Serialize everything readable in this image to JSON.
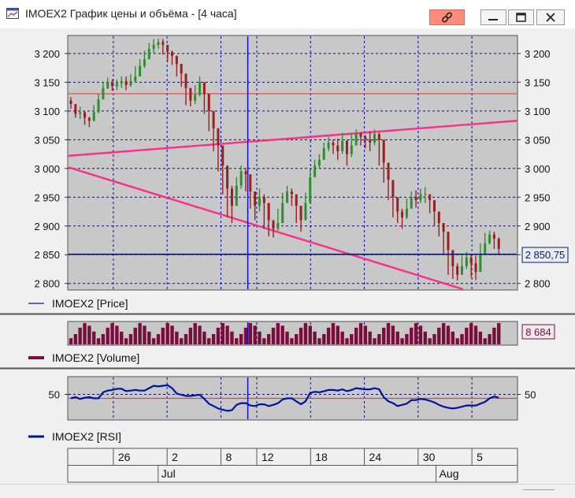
{
  "window": {
    "title": "IMOEX2 График цены и объёма - [4 часа]",
    "icons": {
      "app": "chart-icon",
      "link": "link-icon",
      "minimize": "minimize-icon",
      "maximize": "maximize-icon",
      "close": "close-icon"
    }
  },
  "colors": {
    "panel_bg": "#c8c8c8",
    "grid": "#0a0a9a",
    "up_candle": "#2f8f2f",
    "down_candle": "#9b1f1f",
    "trendline": "#ff2d8a",
    "level_line": "#e84040",
    "cursor": "#1010c0",
    "current_price": "#0a1a6a",
    "volume": "#7a0e3a",
    "rsi": "#00139f",
    "rsi_level": "#e84040"
  },
  "price_panel": {
    "legend": "IMOEX2 [Price]",
    "y_ticks": [
      "3 200",
      "3 150",
      "3 100",
      "3 050",
      "3 000",
      "2 950",
      "2 900",
      "2 850",
      "2 800"
    ],
    "current_value": "2 850,75"
  },
  "volume_panel": {
    "legend": "IMOEX2 [Volume]",
    "current_value": "8 684"
  },
  "rsi_panel": {
    "legend": "IMOEX2 [RSI]",
    "y_ticks": [
      "50"
    ]
  },
  "x_axis": {
    "day_ticks": [
      "26",
      "2",
      "8",
      "12",
      "18",
      "24",
      "30",
      "5"
    ],
    "month_ticks": [
      "Jul",
      "Aug"
    ]
  },
  "chart_data": [
    {
      "type": "line",
      "panel": "price",
      "title": "",
      "chart_style": "candlestick",
      "ylim": [
        2790,
        3230
      ],
      "x_range": [
        "06-21",
        "08-10"
      ],
      "x_unit": "MM-DD, 4-hour bars",
      "close": [
        3112,
        3095,
        3098,
        3088,
        3083,
        3098,
        3120,
        3140,
        3150,
        3143,
        3148,
        3152,
        3145,
        3152,
        3160,
        3178,
        3190,
        3208,
        3215,
        3220,
        3215,
        3203,
        3196,
        3182,
        3165,
        3140,
        3118,
        3128,
        3150,
        3130,
        3100,
        3070,
        3040,
        3005,
        2965,
        2935,
        2970,
        2995,
        2990,
        2960,
        2935,
        2950,
        2940,
        2910,
        2895,
        2905,
        2940,
        2960,
        2955,
        2935,
        2910,
        2940,
        2985,
        3005,
        3015,
        3035,
        3045,
        3040,
        3030,
        3048,
        3025,
        3040,
        3060,
        3055,
        3050,
        3045,
        3060,
        3050,
        3010,
        2980,
        2950,
        2925,
        2915,
        2930,
        2950,
        2945,
        2955,
        2955,
        2945,
        2925,
        2905,
        2890,
        2858,
        2830,
        2815,
        2830,
        2845,
        2835,
        2820,
        2850,
        2870,
        2885,
        2878,
        2860
      ],
      "high": [
        3124,
        3112,
        3108,
        3100,
        3090,
        3110,
        3130,
        3150,
        3158,
        3155,
        3155,
        3160,
        3160,
        3164,
        3178,
        3190,
        3205,
        3218,
        3225,
        3226,
        3225,
        3212,
        3205,
        3196,
        3175,
        3160,
        3130,
        3145,
        3160,
        3150,
        3120,
        3090,
        3060,
        3030,
        2980,
        2970,
        2985,
        3005,
        3000,
        2985,
        2960,
        2965,
        2955,
        2930,
        2905,
        2930,
        2958,
        2970,
        2965,
        2950,
        2935,
        2958,
        2998,
        3015,
        3025,
        3045,
        3055,
        3050,
        3052,
        3062,
        3050,
        3060,
        3068,
        3063,
        3058,
        3065,
        3068,
        3062,
        3040,
        3000,
        2965,
        2945,
        2930,
        2948,
        2960,
        2962,
        2965,
        2968,
        2955,
        2945,
        2920,
        2905,
        2875,
        2855,
        2835,
        2848,
        2855,
        2850,
        2848,
        2870,
        2888,
        2892,
        2890,
        2880
      ],
      "low": [
        3104,
        3088,
        3086,
        3076,
        3072,
        3082,
        3096,
        3122,
        3138,
        3135,
        3136,
        3140,
        3136,
        3142,
        3150,
        3160,
        3175,
        3192,
        3200,
        3208,
        3198,
        3185,
        3180,
        3160,
        3142,
        3110,
        3108,
        3112,
        3125,
        3095,
        3065,
        3030,
        2995,
        2955,
        2915,
        2905,
        2940,
        2965,
        2960,
        2930,
        2910,
        2925,
        2895,
        2882,
        2880,
        2892,
        2920,
        2945,
        2935,
        2905,
        2890,
        2920,
        2955,
        2985,
        3000,
        3018,
        3030,
        3025,
        3015,
        3025,
        3005,
        3020,
        3040,
        3040,
        3035,
        3030,
        3040,
        3005,
        2975,
        2945,
        2915,
        2905,
        2895,
        2912,
        2935,
        2932,
        2940,
        2940,
        2922,
        2900,
        2882,
        2850,
        2815,
        2808,
        2805,
        2815,
        2825,
        2810,
        2806,
        2830,
        2855,
        2868,
        2860,
        2852
      ],
      "horizontal_level": 3130,
      "current_price": 2850.75,
      "trendlines": [
        {
          "from": [
            "06-21",
            3022
          ],
          "to": [
            "08-10",
            3083
          ]
        },
        {
          "from": [
            "06-21",
            3002
          ],
          "to": [
            "08-04",
            2790
          ]
        }
      ],
      "cursor_date": "07-11"
    },
    {
      "type": "bar",
      "panel": "volume",
      "title": "",
      "values_in_range": [
        2500,
        8684
      ],
      "last_value": 8684,
      "bar_count": 94
    },
    {
      "type": "line",
      "panel": "rsi",
      "title": "",
      "ylim": [
        15,
        85
      ],
      "level": 50,
      "values": [
        50,
        52,
        49,
        51,
        52,
        50,
        50,
        60,
        63,
        64,
        66,
        66,
        62,
        63,
        64,
        63,
        63,
        67,
        71,
        70,
        71,
        72,
        67,
        58,
        56,
        54,
        54,
        55,
        56,
        49,
        41,
        37,
        33,
        31,
        29,
        30,
        39,
        42,
        42,
        38,
        37,
        40,
        40,
        37,
        39,
        42,
        48,
        50,
        50,
        45,
        40,
        45,
        59,
        61,
        60,
        62,
        64,
        64,
        63,
        65,
        62,
        64,
        67,
        66,
        65,
        65,
        67,
        65,
        52,
        45,
        42,
        37,
        39,
        41,
        47,
        47,
        49,
        48,
        46,
        43,
        39,
        36,
        34,
        33,
        34,
        36,
        38,
        38,
        38,
        41,
        44,
        50,
        53,
        51
      ]
    }
  ]
}
